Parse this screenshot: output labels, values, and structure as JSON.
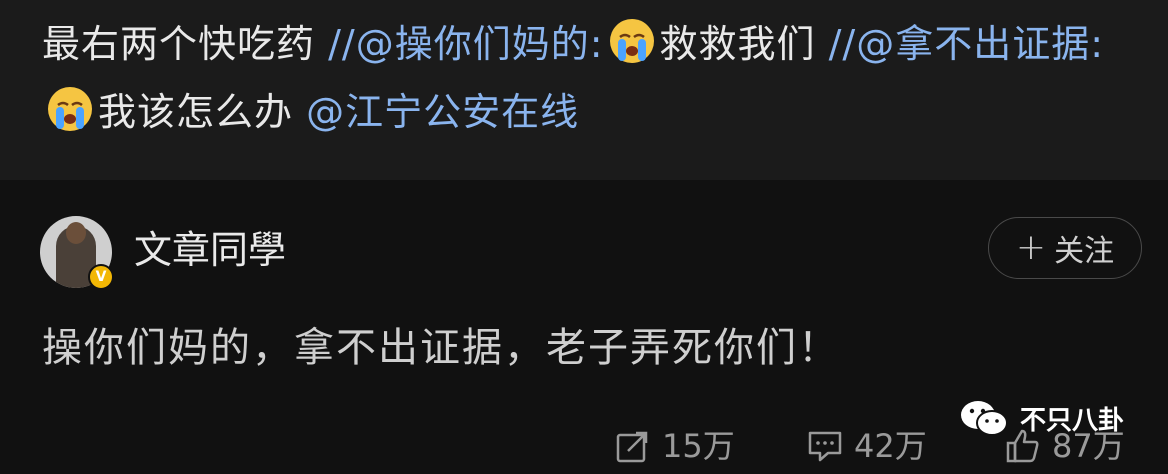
{
  "top_comment": {
    "text_1": "最右两个快吃药 ",
    "link_1": "//@操你们妈的:",
    "text_2": "救救我们 ",
    "link_2": "//@拿不出证据:",
    "text_3": "我该怎么办 ",
    "link_3": "@江宁公安在线",
    "emoji_name": "crying-emoji"
  },
  "post": {
    "username": "文章同學",
    "verified_badge": "V",
    "follow_plus": "+",
    "follow_label": "关注",
    "content": "操你们妈的，拿不出证据，老子弄死你们！"
  },
  "actions": {
    "repost_count": "15万",
    "comment_count": "42万",
    "like_count": "87万"
  },
  "watermark": {
    "label": "不只八卦",
    "icon": "wechat-icon"
  },
  "colors": {
    "link": "#8ab4ee",
    "background": "#111111",
    "top_block": "#1b1b1b",
    "text": "#e9e9e9",
    "muted": "#9a9a9a"
  }
}
